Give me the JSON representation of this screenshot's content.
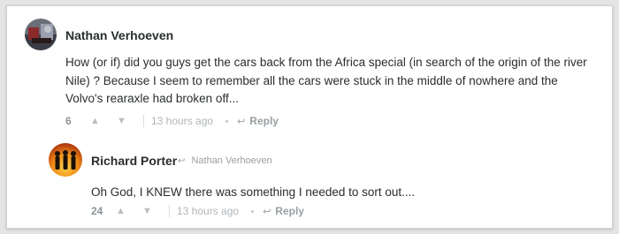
{
  "comments": [
    {
      "author": "Nathan Verhoeven",
      "body": "How (or if) did you guys get the cars back from the Africa special (in search of the origin of the river Nile) ? Because I seem to remember all the cars were stuck in the middle of nowhere and the Volvo's rearaxle had broken off...",
      "votes": "6",
      "time": "13 hours ago",
      "reply_label": "Reply",
      "upvote_icon": "▲",
      "downvote_icon": "▼",
      "reply_icon": "↩"
    },
    {
      "author": "Richard Porter",
      "reply_to": "Nathan Verhoeven",
      "reply_to_icon": "↩",
      "body": "Oh God, I KNEW there was something I needed to sort out....",
      "votes": "24",
      "time": "13 hours ago",
      "reply_label": "Reply",
      "upvote_icon": "▲",
      "downvote_icon": "▼",
      "reply_icon": "↩"
    }
  ],
  "colors": {
    "text": "#2a2e2e",
    "muted": "#9aa0a3",
    "background": "#e4e4e4"
  }
}
